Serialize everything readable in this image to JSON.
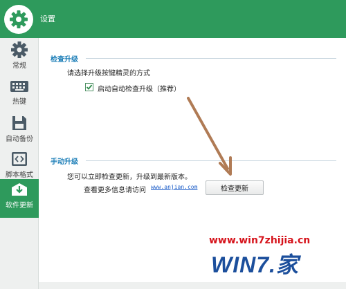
{
  "window": {
    "title": "设置"
  },
  "sidebar": {
    "items": [
      {
        "label": "常规",
        "icon": "gear-icon"
      },
      {
        "label": "热键",
        "icon": "keyboard-icon"
      },
      {
        "label": "自动备份",
        "icon": "floppy-disk-icon"
      },
      {
        "label": "脚本格式",
        "icon": "code-brackets-icon"
      },
      {
        "label": "软件更新",
        "icon": "update-box-icon",
        "active": true
      }
    ]
  },
  "upgrade_section": {
    "title": "检查升级",
    "prompt": "请选择升级按键精灵的方式",
    "auto_check_label": "启动自动检查升级（推荐）",
    "auto_check_checked": true
  },
  "manual_section": {
    "title": "手动升级",
    "description": "您可以立即检查更新，升级到最新版本。",
    "more_info_label": "查看更多信息请访问",
    "link_text": "www.anjian.com",
    "check_button_label": "检查更新"
  },
  "watermark": {
    "url": "www.win7zhijia.cn",
    "logo": "WIN7.家"
  },
  "colors": {
    "accent_green": "#2e9a5c",
    "section_blue": "#1e7fb8",
    "annotation_arrow": "#b07b55",
    "watermark_red": "#d6141c",
    "watermark_blue": "#1c4f9c"
  }
}
